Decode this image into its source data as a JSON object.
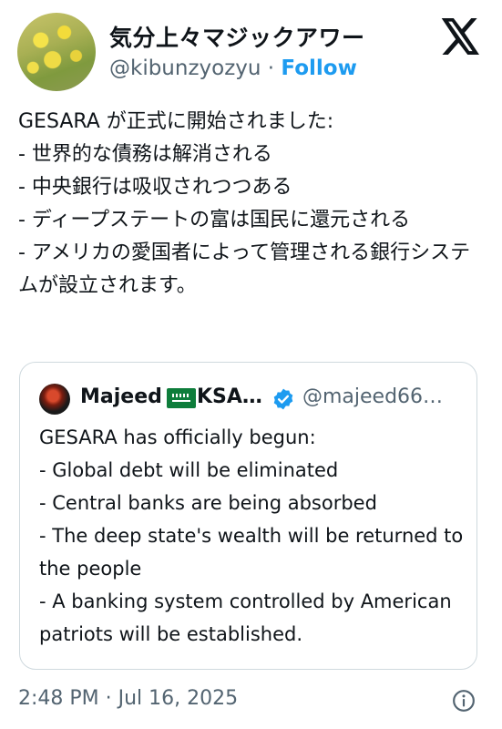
{
  "tweet": {
    "display_name": "気分上々マジックアワー",
    "handle": "@kibunzyozyu",
    "separator": " · ",
    "follow_label": "Follow",
    "text": "GESARA が正式に開始されました:\n- 世界的な債務は解消される\n- 中央銀行は吸収されつつある\n- ディープステートの富は国民に還元される\n- アメリカの愛国者によって管理される銀行システムが設立されます。",
    "timestamp": "2:48 PM · Jul 16, 2025"
  },
  "quote": {
    "name": "Majeed",
    "name_suffix": "KSA…",
    "handle": "@majeed66…",
    "text": "GESARA has officially begun:\n- Global debt will be eliminated\n- Central banks are being absorbed\n- The deep state's wealth will be returned to the people\n- A banking system controlled by American patriots will be established."
  },
  "icons": {
    "logo": "x-logo-icon",
    "verified": "verified-badge-icon",
    "flag": "saudi-flag-icon",
    "info": "info-icon"
  },
  "colors": {
    "link": "#1d9bf0",
    "secondary_text": "#536471",
    "border": "#cfd9de"
  }
}
